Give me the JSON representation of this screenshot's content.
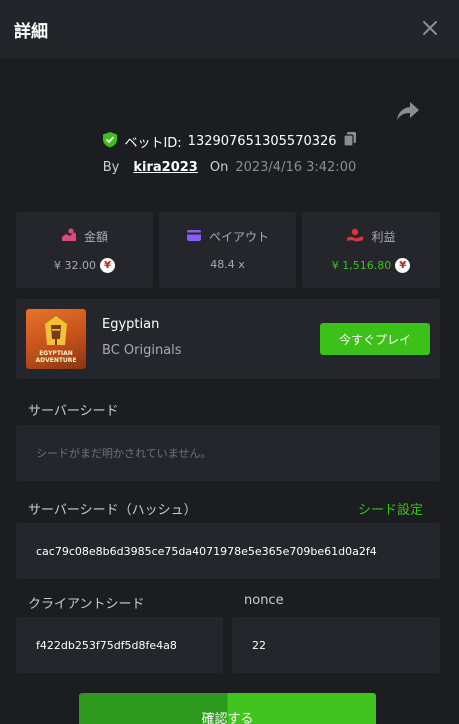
{
  "header": {
    "title": "詳細"
  },
  "bet": {
    "id_label": "ベットID:",
    "id": "132907651305570326",
    "by_label": "By",
    "user": "kira2023",
    "on_label": "On",
    "date": "2023/4/16 3:42:00"
  },
  "stats": {
    "amount": {
      "label": "金額",
      "value": "¥ 32.00"
    },
    "payout": {
      "label": "ペイアウト",
      "value": "48.4 x"
    },
    "profit": {
      "label": "利益",
      "value": "¥ 1,516.80"
    },
    "coin_symbol": "¥"
  },
  "game": {
    "name": "Egyptian",
    "provider": "BC Originals",
    "play_label": "今すぐプレイ",
    "logo_text_1": "EGYPTIAN",
    "logo_text_2": "ADVENTURE"
  },
  "server_seed": {
    "label": "サーバーシード",
    "placeholder": "シードがまだ明かされていません。"
  },
  "server_seed_hash": {
    "label": "サーバーシード（ハッシュ）",
    "link": "シード設定",
    "value": "cac79c08e8b6d3985ce75da4071978e5e365e709be61d0a2f4"
  },
  "client_seed": {
    "label": "クライアントシード",
    "value": "f422db253f75df5d8fe4a8"
  },
  "nonce": {
    "label": "nonce",
    "value": "22"
  },
  "verify_label": "確認する",
  "colors": {
    "accent_green": "#3bc117",
    "profit_green": "#3bc117",
    "amount_icon": "#e0487c",
    "payout_icon": "#8b5cf6",
    "profit_icon": "#e0343a"
  }
}
